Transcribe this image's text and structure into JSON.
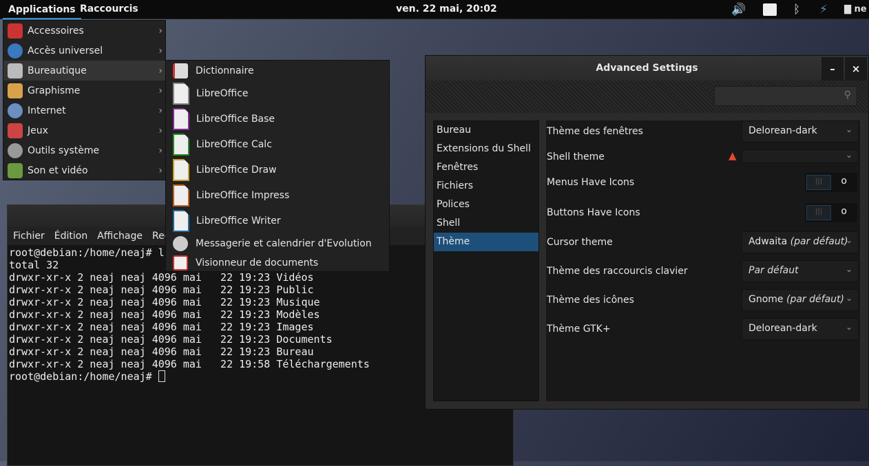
{
  "topbar": {
    "applications": "Applications",
    "shortcuts": "Raccourcis",
    "clock": "ven. 22 mai, 20:02",
    "user": "ne"
  },
  "app_menu": [
    {
      "label": "Accessoires",
      "color": "#c33"
    },
    {
      "label": "Accès universel",
      "color": "#3a78c0"
    },
    {
      "label": "Bureautique",
      "color": "#bbb"
    },
    {
      "label": "Graphisme",
      "color": "#d9a24a"
    },
    {
      "label": "Internet",
      "color": "#6a8fc0"
    },
    {
      "label": "Jeux",
      "color": "#c44"
    },
    {
      "label": "Outils système",
      "color": "#999"
    },
    {
      "label": "Son et vidéo",
      "color": "#6a9a40"
    }
  ],
  "submenu": [
    {
      "label": "Dictionnaire"
    },
    {
      "label": "LibreOffice",
      "color": "#888"
    },
    {
      "label": "LibreOffice Base",
      "color": "#8a2a9a"
    },
    {
      "label": "LibreOffice Calc",
      "color": "#2a8a2a"
    },
    {
      "label": "LibreOffice Draw",
      "color": "#c8a020"
    },
    {
      "label": "LibreOffice Impress",
      "color": "#c06020"
    },
    {
      "label": "LibreOffice Writer",
      "color": "#1f6aa0"
    },
    {
      "label": "Messagerie et calendrier d'Evolution"
    },
    {
      "label": "Visionneur de documents"
    }
  ],
  "terminal": {
    "title": "Termi",
    "menu": [
      "Fichier",
      "Édition",
      "Affichage",
      "Rec"
    ],
    "lines": [
      "root@debian:/home/neaj# ls",
      "total 32",
      "drwxr-xr-x 2 neaj neaj 4096 mai   22 19:23 Vidéos",
      "drwxr-xr-x 2 neaj neaj 4096 mai   22 19:23 Public",
      "drwxr-xr-x 2 neaj neaj 4096 mai   22 19:23 Musique",
      "drwxr-xr-x 2 neaj neaj 4096 mai   22 19:23 Modèles",
      "drwxr-xr-x 2 neaj neaj 4096 mai   22 19:23 Images",
      "drwxr-xr-x 2 neaj neaj 4096 mai   22 19:23 Documents",
      "drwxr-xr-x 2 neaj neaj 4096 mai   22 19:23 Bureau",
      "drwxr-xr-x 2 neaj neaj 4096 mai   22 19:58 Téléchargements"
    ],
    "prompt": "root@debian:/home/neaj# "
  },
  "adv": {
    "title": "Advanced Settings",
    "minimize": "–",
    "close": "×",
    "sidebar": [
      "Bureau",
      "Extensions du Shell",
      "Fenêtres",
      "Fichiers",
      "Polices",
      "Shell",
      "Thème"
    ],
    "settings": {
      "window_theme": {
        "label": "Thème des fenêtres",
        "value": "Delorean-dark"
      },
      "shell_theme": {
        "label": "Shell theme",
        "value": ""
      },
      "menus_icons": {
        "label": "Menus Have Icons",
        "state": "off"
      },
      "buttons_icons": {
        "label": "Buttons Have Icons",
        "state": "off"
      },
      "cursor_theme": {
        "label": "Cursor theme",
        "value": "Adwaita",
        "suffix": "(par défaut)"
      },
      "keys_theme": {
        "label": "Thème des raccourcis clavier",
        "value": "Par défaut"
      },
      "icon_theme": {
        "label": "Thème des icônes",
        "value": "Gnome",
        "suffix": "(par défaut)"
      },
      "gtk_theme": {
        "label": "Thème GTK+",
        "value": "Delorean-dark"
      }
    }
  }
}
